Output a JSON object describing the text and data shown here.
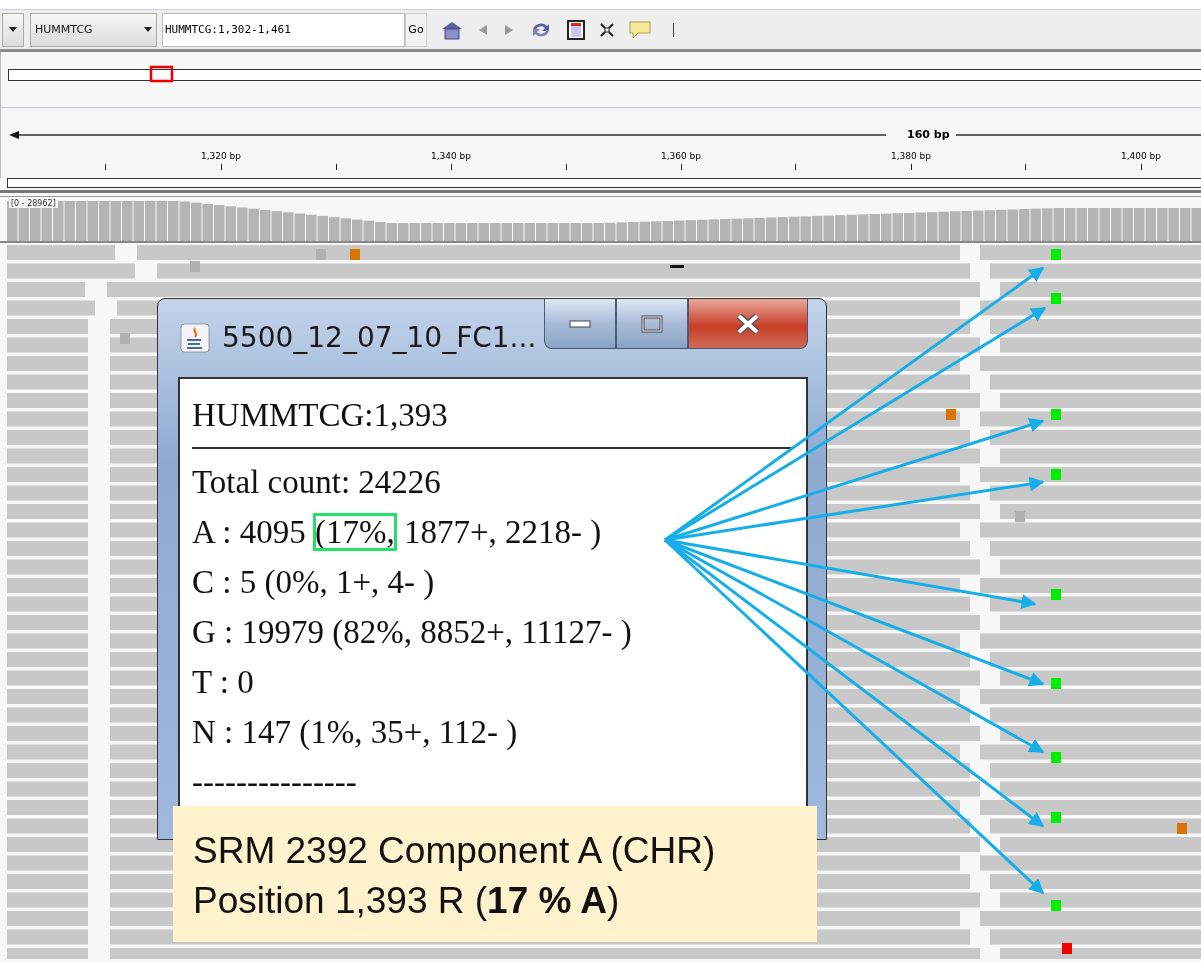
{
  "toolbar": {
    "chromosome": "HUMMTCG",
    "locus": "HUMMTCG:1,302-1,461",
    "go": "Go"
  },
  "ruler": {
    "span": "160 bp",
    "labels": [
      "1,320 bp",
      "1,340 bp",
      "1,360 bp",
      "1,380 bp",
      "1,400 bp"
    ]
  },
  "coverage": {
    "range": "[0 - 28962]"
  },
  "popup": {
    "title": "5500_12_07_10_FC1...",
    "locus": "HUMMTCG:1,393",
    "lines": [
      {
        "parts": [
          {
            "text": "Total count: 24226",
            "boxed": false
          }
        ]
      },
      {
        "parts": [
          {
            "text": "A : 4095 ",
            "boxed": false
          },
          {
            "text": "(17%,",
            "boxed": true
          },
          {
            "text": " 1877+, 2218- )",
            "boxed": false
          }
        ]
      },
      {
        "parts": [
          {
            "text": "C : 5 (0%, 1+, 4- )",
            "boxed": false
          }
        ]
      },
      {
        "parts": [
          {
            "text": "G : 19979 (82%, 8852+, 11127- )",
            "boxed": false
          }
        ]
      },
      {
        "parts": [
          {
            "text": "T : 0",
            "boxed": false
          }
        ]
      },
      {
        "parts": [
          {
            "text": "N : 147 (1%, 35+, 112- )",
            "boxed": false
          }
        ]
      },
      {
        "parts": [
          {
            "text": "---------------",
            "boxed": false
          }
        ]
      }
    ]
  },
  "callout": {
    "lines": [
      "SRM 2392 Component A (CHR)",
      "Position 1,393 R (**17 % A**)"
    ]
  }
}
